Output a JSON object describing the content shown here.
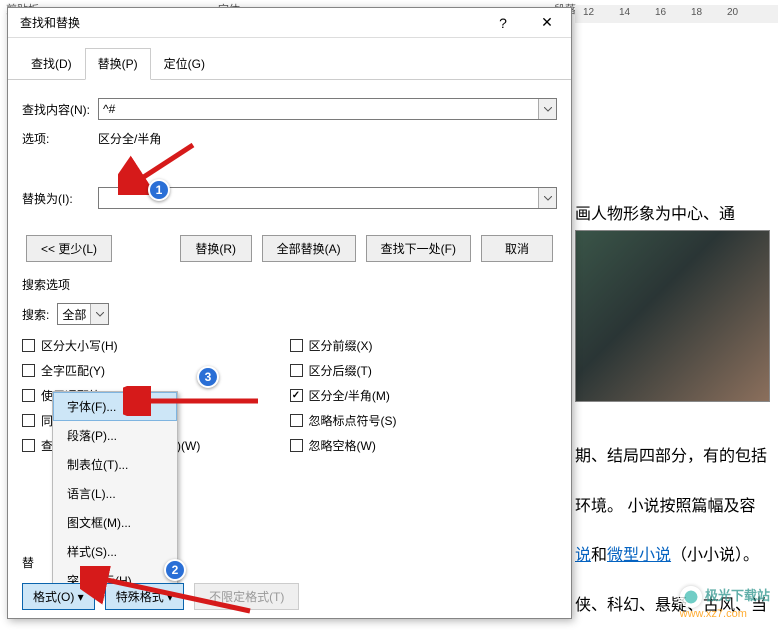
{
  "top": {
    "label_left": "剪贴板",
    "label_mid": "字体",
    "label_right": "段落",
    "ruler": [
      "12",
      "14",
      "16",
      "18",
      "20"
    ]
  },
  "dialog": {
    "title": "查找和替换",
    "help_symbol": "?",
    "close_symbol": "✕",
    "tabs": {
      "find": "查找(D)",
      "replace": "替换(P)",
      "goto": "定位(G)"
    },
    "find_label": "查找内容(N):",
    "find_value": "^#",
    "options_label": "选项:",
    "options_value": "区分全/半角",
    "replace_label": "替换为(I):",
    "replace_value": "",
    "buttons": {
      "less": "<< 更少(L)",
      "replace": "替换(R)",
      "replace_all": "全部替换(A)",
      "find_next": "查找下一处(F)",
      "cancel": "取消"
    },
    "search_section": "搜索选项",
    "search_label": "搜索:",
    "search_value": "全部",
    "checks_left": [
      {
        "label": "区分大小写(H)",
        "checked": false
      },
      {
        "label": "全字匹配(Y)",
        "checked": false
      },
      {
        "label": "使用通配符(U)",
        "checked": false
      },
      {
        "label": "同音(英文)(K)",
        "checked": false
      },
      {
        "label": "查找单词的所有形式(英文)(W)",
        "checked": false
      }
    ],
    "checks_right": [
      {
        "label": "区分前缀(X)",
        "checked": false
      },
      {
        "label": "区分后缀(T)",
        "checked": false
      },
      {
        "label": "区分全/半角(M)",
        "checked": true
      },
      {
        "label": "忽略标点符号(S)",
        "checked": false
      },
      {
        "label": "忽略空格(W)",
        "checked": false
      }
    ],
    "bottom_label": "替",
    "format_btn": "格式(O) ▾",
    "special_btn": "特殊格式",
    "nofmt_btn": "不限定格式(T)"
  },
  "popup": {
    "items": [
      "字体(F)...",
      "段落(P)...",
      "制表位(T)...",
      "语言(L)...",
      "图文框(M)...",
      "样式(S)...",
      "突出显示(H)"
    ]
  },
  "background": {
    "line1": "画人物形象为中心、通",
    "line2_a": "期、结局四部分，有的包括",
    "line2_b": "环境。 小说按照篇幅及容",
    "line2_c_pre": "说",
    "line2_c_and": "和",
    "line2_c_link": "微型小说",
    "line2_c_post": "（小小说）。",
    "line2_d": "侠、科幻、悬疑、古风、当"
  },
  "watermark": {
    "t1": "极光下载站",
    "t2": "www.xz7.com"
  }
}
